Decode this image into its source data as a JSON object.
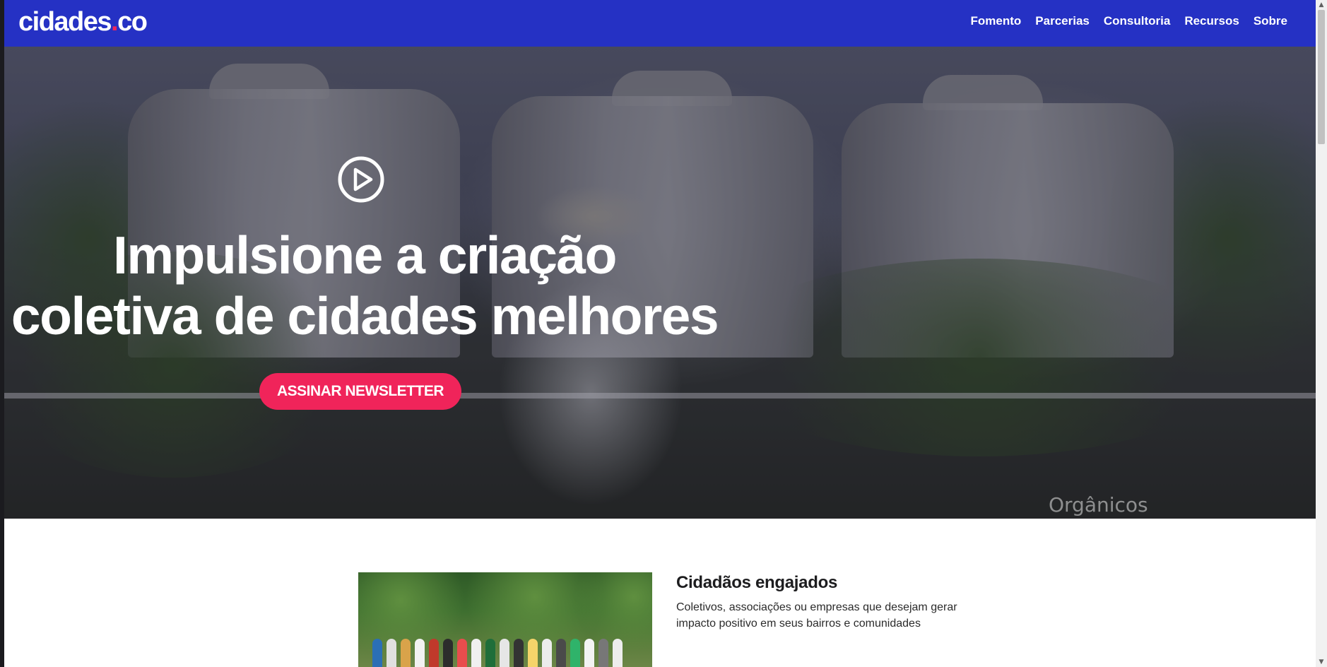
{
  "brand": {
    "logo_main": "cidades",
    "logo_dot": ".",
    "logo_tld": "co"
  },
  "nav": {
    "items": [
      "Fomento",
      "Parcerias",
      "Consultoria",
      "Recursos",
      "Sobre"
    ]
  },
  "hero": {
    "headline_line1": "Impulsione a criação",
    "headline_line2": "coletiva de cidades melhores",
    "cta_label": "ASSINAR NEWSLETTER",
    "video_watermark": "Orgânicos"
  },
  "feature": {
    "title": "Cidadãos engajados",
    "description": "Coletivos, associações ou empresas que desejam gerar impacto positivo em seus bairros e comunidades"
  },
  "colors": {
    "header_bg": "#2531c4",
    "accent": "#f0245a"
  },
  "icons": {
    "play": "play-circle-icon"
  }
}
